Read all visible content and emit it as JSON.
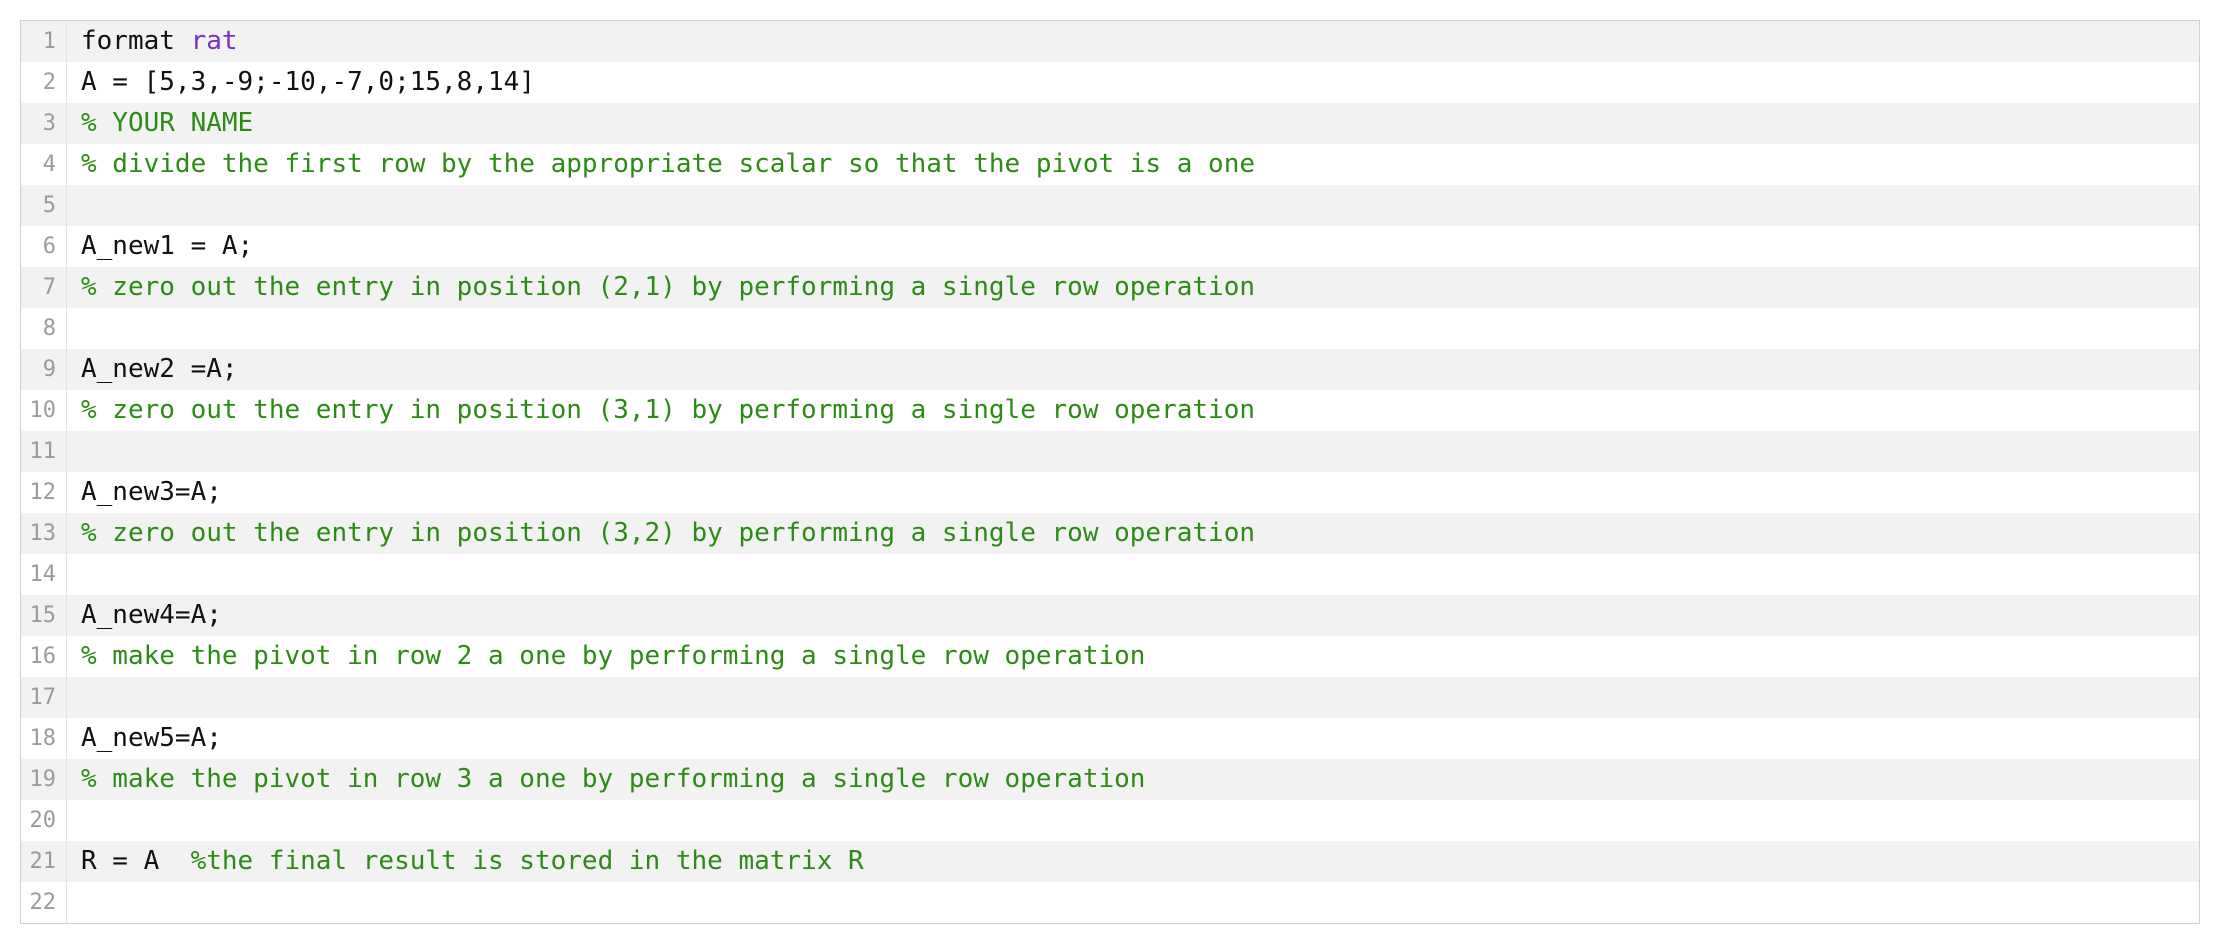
{
  "editor": {
    "lines": [
      {
        "n": "1",
        "bg": "odd",
        "segments": [
          {
            "cls": "tok-kw",
            "t": "format "
          },
          {
            "cls": "tok-fn",
            "t": "rat"
          }
        ]
      },
      {
        "n": "2",
        "bg": "even",
        "segments": [
          {
            "cls": "",
            "t": "A = [5,3,-9;-10,-7,0;15,8,14]"
          }
        ]
      },
      {
        "n": "3",
        "bg": "odd",
        "segments": [
          {
            "cls": "tok-comment",
            "t": "% YOUR NAME"
          }
        ]
      },
      {
        "n": "4",
        "bg": "even",
        "segments": [
          {
            "cls": "tok-comment",
            "t": "% divide the first row by the appropriate scalar so that the pivot is a one"
          }
        ]
      },
      {
        "n": "5",
        "bg": "odd",
        "segments": [
          {
            "cls": "",
            "t": ""
          }
        ]
      },
      {
        "n": "6",
        "bg": "even",
        "segments": [
          {
            "cls": "",
            "t": "A_new1 = A;"
          }
        ]
      },
      {
        "n": "7",
        "bg": "odd",
        "segments": [
          {
            "cls": "tok-comment",
            "t": "% zero out the entry in position (2,1) by performing a single row operation"
          }
        ]
      },
      {
        "n": "8",
        "bg": "even",
        "segments": [
          {
            "cls": "",
            "t": ""
          }
        ]
      },
      {
        "n": "9",
        "bg": "odd",
        "segments": [
          {
            "cls": "",
            "t": "A_new2 =A;"
          }
        ]
      },
      {
        "n": "10",
        "bg": "even",
        "segments": [
          {
            "cls": "tok-comment",
            "t": "% zero out the entry in position (3,1) by performing a single row operation"
          }
        ]
      },
      {
        "n": "11",
        "bg": "odd",
        "segments": [
          {
            "cls": "",
            "t": ""
          }
        ]
      },
      {
        "n": "12",
        "bg": "even",
        "segments": [
          {
            "cls": "",
            "t": "A_new3=A;"
          }
        ]
      },
      {
        "n": "13",
        "bg": "odd",
        "segments": [
          {
            "cls": "tok-comment",
            "t": "% zero out the entry in position (3,2) by performing a single row operation"
          }
        ]
      },
      {
        "n": "14",
        "bg": "even",
        "segments": [
          {
            "cls": "",
            "t": ""
          }
        ]
      },
      {
        "n": "15",
        "bg": "odd",
        "segments": [
          {
            "cls": "",
            "t": "A_new4=A;"
          }
        ]
      },
      {
        "n": "16",
        "bg": "even",
        "segments": [
          {
            "cls": "tok-comment",
            "t": "% make the pivot in row 2 a one by performing a single row operation"
          }
        ]
      },
      {
        "n": "17",
        "bg": "odd",
        "segments": [
          {
            "cls": "",
            "t": ""
          }
        ]
      },
      {
        "n": "18",
        "bg": "even",
        "segments": [
          {
            "cls": "",
            "t": "A_new5=A;"
          }
        ]
      },
      {
        "n": "19",
        "bg": "odd",
        "segments": [
          {
            "cls": "tok-comment",
            "t": "% make the pivot in row 3 a one by performing a single row operation"
          }
        ]
      },
      {
        "n": "20",
        "bg": "even",
        "segments": [
          {
            "cls": "",
            "t": ""
          }
        ]
      },
      {
        "n": "21",
        "bg": "odd",
        "segments": [
          {
            "cls": "",
            "t": "R = A  "
          },
          {
            "cls": "tok-comment",
            "t": "%the final result is stored in the matrix R"
          }
        ]
      },
      {
        "n": "22",
        "bg": "even",
        "segments": [
          {
            "cls": "",
            "t": ""
          }
        ]
      }
    ]
  }
}
